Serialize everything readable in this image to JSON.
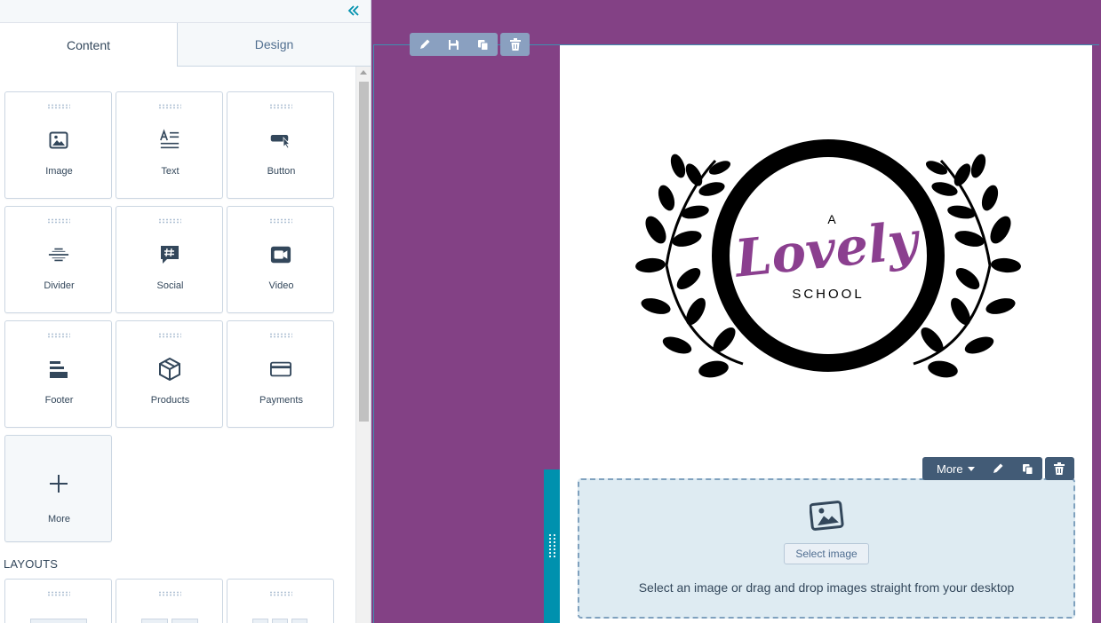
{
  "tabs": {
    "content": "Content",
    "design": "Design"
  },
  "modules": [
    {
      "label": "Image",
      "icon": "image-icon"
    },
    {
      "label": "Text",
      "icon": "text-icon"
    },
    {
      "label": "Button",
      "icon": "button-icon"
    },
    {
      "label": "Divider",
      "icon": "divider-icon"
    },
    {
      "label": "Social",
      "icon": "social-icon"
    },
    {
      "label": "Video",
      "icon": "video-icon"
    },
    {
      "label": "Footer",
      "icon": "footer-icon"
    },
    {
      "label": "Products",
      "icon": "products-icon"
    },
    {
      "label": "Payments",
      "icon": "payments-icon"
    },
    {
      "label": "More",
      "icon": "plus-icon"
    }
  ],
  "layouts_heading": "LAYOUTS",
  "logo": {
    "top": "A",
    "script": "Lovely",
    "bottom": "SCHOOL"
  },
  "image_module": {
    "button_label": "Select image",
    "hint": "Select an image or drag and drop images straight from your desktop"
  },
  "module_toolbar": {
    "more_label": "More"
  },
  "colors": {
    "canvas_bg": "#834185",
    "accent": "#0091ae",
    "toolbar_dark": "#425b76",
    "toolbar_light": "#8aa0c0",
    "logo_purple": "#8b3f8f"
  }
}
